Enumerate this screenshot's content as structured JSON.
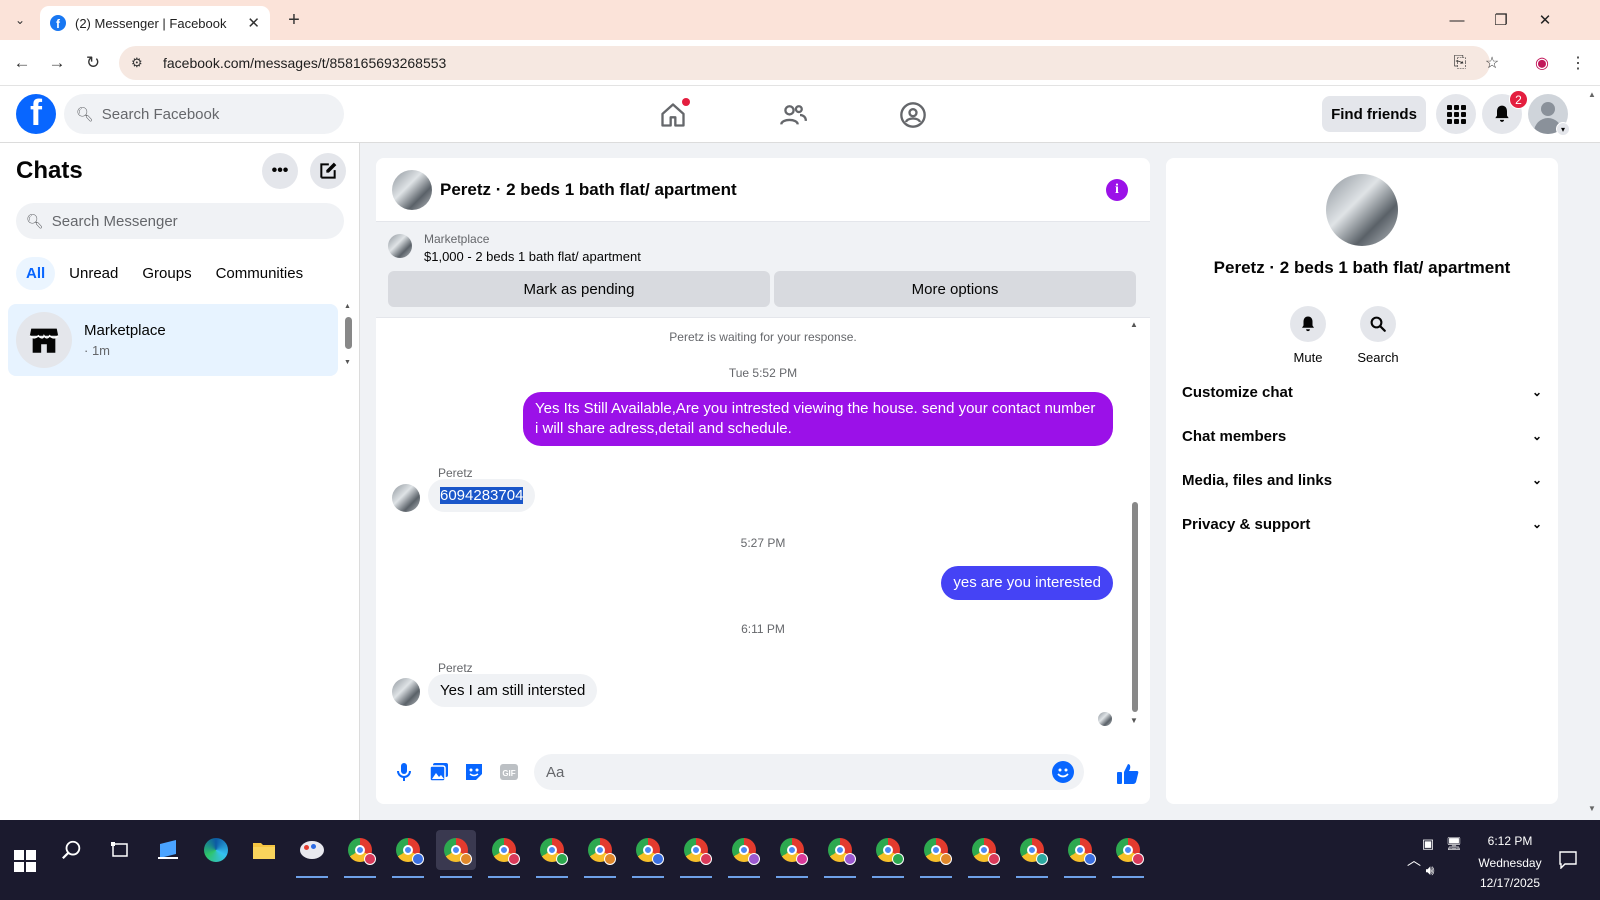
{
  "browser": {
    "tab_title": "(2) Messenger | Facebook",
    "url": "facebook.com/messages/t/858165693268553"
  },
  "fb": {
    "search_placeholder": "Search Facebook",
    "find_friends": "Find friends",
    "notification_count": "2"
  },
  "chats": {
    "title": "Chats",
    "search_placeholder": "Search Messenger",
    "filters": [
      "All",
      "Unread",
      "Groups",
      "Communities"
    ],
    "items": [
      {
        "name": "Marketplace",
        "time": "· 1m"
      }
    ]
  },
  "conversation": {
    "title": "Peretz · 2 beds 1 bath flat/ apartment",
    "marketplace_label": "Marketplace",
    "listing": "$1,000 - 2 beds 1 bath flat/ apartment",
    "mark_pending": "Mark as pending",
    "more_options": "More options",
    "system_note": "Peretz is waiting for your response.",
    "messages": [
      {
        "type": "time",
        "text": "Tue 5:52 PM"
      },
      {
        "type": "out",
        "text": "Yes Its Still Available,Are you intrested viewing the house. send your contact number i will share adress,detail and schedule."
      },
      {
        "type": "sender",
        "text": "Peretz"
      },
      {
        "type": "in",
        "text": "6094283704"
      },
      {
        "type": "time",
        "text": "5:27 PM"
      },
      {
        "type": "out",
        "text": "yes are you interested"
      },
      {
        "type": "time",
        "text": "6:11 PM"
      },
      {
        "type": "sender",
        "text": "Peretz"
      },
      {
        "type": "in",
        "text": "Yes I am still intersted"
      }
    ],
    "composer_placeholder": "Aa"
  },
  "info_panel": {
    "name": "Peretz · 2 beds 1 bath flat/ apartment",
    "actions": [
      "Mute",
      "Search"
    ],
    "sections": [
      "Customize chat",
      "Chat members",
      "Media, files and links",
      "Privacy & support"
    ]
  },
  "taskbar": {
    "time": "6:12 PM",
    "day": "Wednesday",
    "date": "12/17/2025"
  },
  "colors": {
    "fb_blue": "#0866ff",
    "outgoing_purple": "#9b11e8",
    "outgoing_blue": "#4543f5",
    "notification_red": "#e41e3f"
  }
}
